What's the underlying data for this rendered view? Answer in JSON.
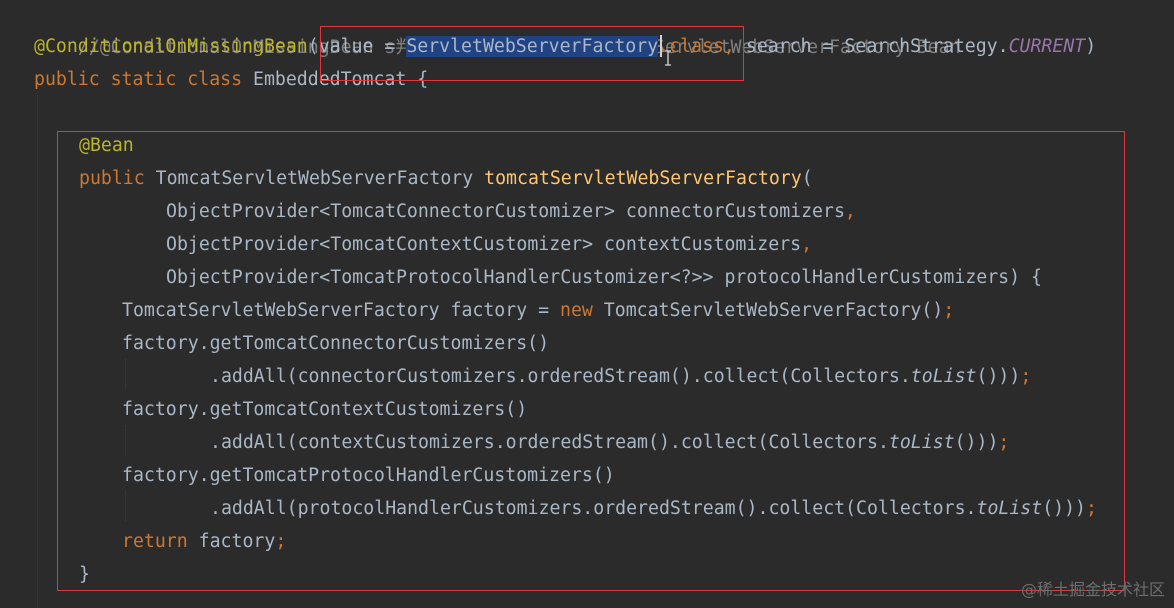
{
  "editor": {
    "lines": {
      "l0": {
        "comment": "//@ConditionalOnMissingBean s判断Spring容器里面 没有一个ServletWebServerFactory Bean"
      },
      "l1": {
        "anno": "@ConditionalOnMissingBean",
        "paren_open": "(",
        "value_kw": "value = ",
        "selected": "ServletWebServerFactory",
        "dot_class": ".class",
        "comma": ", ",
        "search": "search = SearchStrategy.",
        "current": "CURRENT",
        "paren_close": ")"
      },
      "l2": {
        "kw": "public static class ",
        "name": "EmbeddedTomcat ",
        "brace": "{"
      },
      "l3": {
        "anno": "@Bean"
      },
      "l4": {
        "kw": "public ",
        "type": "TomcatServletWebServerFactory ",
        "method": "tomcatServletWebServerFactory",
        "paren": "("
      },
      "l5": {
        "text": "ObjectProvider<TomcatConnectorCustomizer> connectorCustomizers",
        "comma": ","
      },
      "l6": {
        "text": "ObjectProvider<TomcatContextCustomizer> contextCustomizers",
        "comma": ","
      },
      "l7": {
        "text": "ObjectProvider<TomcatProtocolHandlerCustomizer<?>> protocolHandlerCustomizers) {"
      },
      "l8": {
        "pre": "TomcatServletWebServerFactory factory = ",
        "kw": "new",
        "post": " TomcatServletWebServerFactory()",
        "semi": ";"
      },
      "l9": {
        "text": "factory.getTomcatConnectorCustomizers()"
      },
      "l10": {
        "pre": ".addAll(connectorCustomizers.orderedStream().collect(Collectors.",
        "it": "toList",
        "post": "()))",
        "semi": ";"
      },
      "l11": {
        "text": "factory.getTomcatContextCustomizers()"
      },
      "l12": {
        "pre": ".addAll(contextCustomizers.orderedStream().collect(Collectors.",
        "it": "toList",
        "post": "()))",
        "semi": ";"
      },
      "l13": {
        "text": "factory.getTomcatProtocolHandlerCustomizers()"
      },
      "l14": {
        "pre": ".addAll(protocolHandlerCustomizers.orderedStream().collect(Collectors.",
        "it": "toList",
        "post": "()))",
        "semi": ";"
      },
      "l15": {
        "kw": "return",
        "post": " factory",
        "semi": ";"
      },
      "l16": {
        "text": "}"
      }
    }
  },
  "watermark": "@稀土掘金技术社区",
  "colors": {
    "background": "#2b2b2b",
    "keyword": "#cc7832",
    "annotation": "#bbb529",
    "comment": "#808080",
    "method": "#ffc66d",
    "static_field": "#9876aa",
    "plain": "#a9b7c6",
    "selection": "#214283",
    "highlight_box": "#e0363c"
  }
}
